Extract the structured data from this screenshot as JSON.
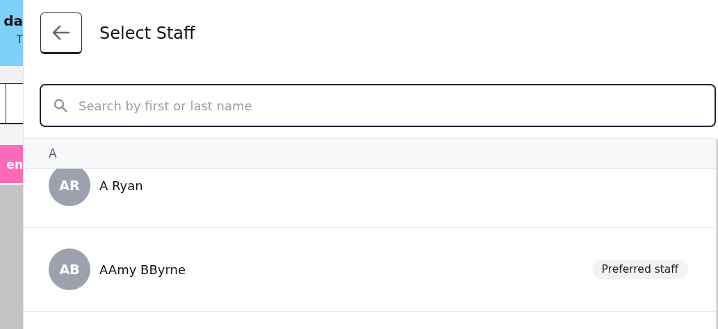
{
  "background": {
    "header_title": "da",
    "header_subtitle": "T",
    "event_label": "en"
  },
  "panel": {
    "title": "Select Staff",
    "search": {
      "placeholder": "Search by first or last name"
    },
    "sections": [
      {
        "letter": "A",
        "staff": [
          {
            "initials": "AR",
            "name": "A Ryan"
          },
          {
            "initials": "AB",
            "name": "AAmy BByrne",
            "badge": "Preferred staff"
          }
        ]
      }
    ]
  }
}
